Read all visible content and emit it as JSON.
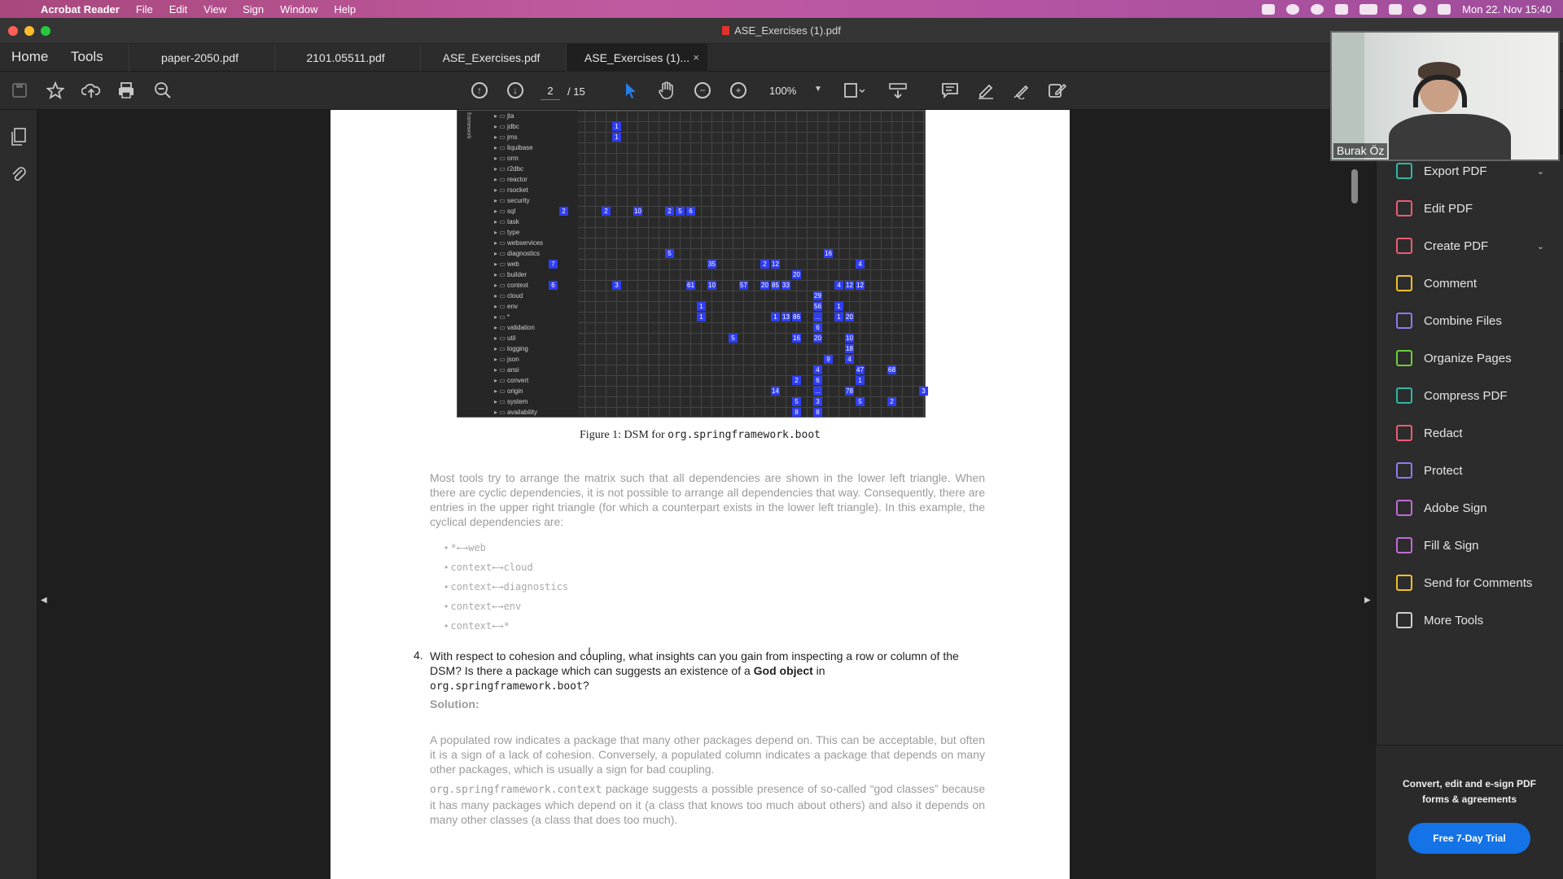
{
  "menubar": {
    "app": "Acrobat Reader",
    "items": [
      "File",
      "Edit",
      "View",
      "Sign",
      "Window",
      "Help"
    ],
    "datetime": "Mon 22. Nov  15:40"
  },
  "window": {
    "title": "ASE_Exercises (1).pdf"
  },
  "nav": {
    "home": "Home",
    "tools": "Tools"
  },
  "tabs": [
    {
      "label": "paper-2050.pdf"
    },
    {
      "label": "2101.05511.pdf"
    },
    {
      "label": "ASE_Exercises.pdf"
    },
    {
      "label": "ASE_Exercises (1)...",
      "close": "×"
    }
  ],
  "toolbar": {
    "page_current": "2",
    "page_total": "/ 15",
    "zoom": "100%"
  },
  "dsm": {
    "side_label": "framework",
    "rows": [
      "jta",
      "jdbc",
      "jms",
      "liquibase",
      "orm",
      "r2dbc",
      "reactor",
      "rsocket",
      "security",
      "sql",
      "task",
      "type",
      "webservices",
      "diagnostics",
      "web",
      "builder",
      "context",
      "cloud",
      "env",
      "*",
      "validation",
      "util",
      "logging",
      "json",
      "ansi",
      "convert",
      "origin",
      "system",
      "availability"
    ]
  },
  "document": {
    "caption_prefix": "Figure 1: DSM for ",
    "caption_code": "org.springframework.boot",
    "para1": "Most tools try to arrange the matrix such that all dependencies are shown in the lower left triangle. When there are cyclic dependencies, it is not possible to arrange all dependencies that way. Consequently, there are entries in the upper right triangle (for which a counterpart exists in the lower left triangle). In this example, the cyclical dependencies are:",
    "bullets": [
      "*←→web",
      "context←→cloud",
      "context←→diagnostics",
      "context←→env",
      "context←→*"
    ],
    "q4_number": "4.",
    "q4_text1": "With respect to cohesion and coupling, what insights can you gain from inspecting a row or column of the DSM? Is there a package which can suggests an existence of a ",
    "q4_bold": "God object",
    "q4_text2": " in",
    "q4_code": "org.springframework.boot",
    "q4_end": "?",
    "solution_label": "Solution:",
    "sol_para1": "A populated row indicates a package that many other packages depend on. This can be acceptable, but often it is a sign of a lack of cohesion. Conversely, a populated column indicates a package that depends on many other packages, which is usually a sign for bad coupling.",
    "sol_code": "org.springframework.context",
    "sol_para2": " package suggests a possible presence of so-called “god classes” because it has many packages which depend on it (a class that knows too much about others) and also it depends on many other classes (a class that does too much)."
  },
  "tools_panel": {
    "items": [
      {
        "label": "Export PDF",
        "color": "#2db9a5",
        "dropdown": true
      },
      {
        "label": "Edit PDF",
        "color": "#ec5b73"
      },
      {
        "label": "Create PDF",
        "color": "#ec5b73",
        "dropdown": true
      },
      {
        "label": "Comment",
        "color": "#f2c02b"
      },
      {
        "label": "Combine Files",
        "color": "#8c7bf0"
      },
      {
        "label": "Organize Pages",
        "color": "#6ccf3b"
      },
      {
        "label": "Compress PDF",
        "color": "#2db9a5"
      },
      {
        "label": "Redact",
        "color": "#ec5b73"
      },
      {
        "label": "Protect",
        "color": "#8c7bf0"
      },
      {
        "label": "Adobe Sign",
        "color": "#c06ad8"
      },
      {
        "label": "Fill & Sign",
        "color": "#c06ad8"
      },
      {
        "label": "Send for Comments",
        "color": "#f2c02b"
      },
      {
        "label": "More Tools",
        "color": "#cfcfcf"
      }
    ],
    "promo_text": "Convert, edit and e-sign PDF forms & agreements",
    "trial_button": "Free 7-Day Trial"
  },
  "video": {
    "participant": "Burak Öz"
  }
}
